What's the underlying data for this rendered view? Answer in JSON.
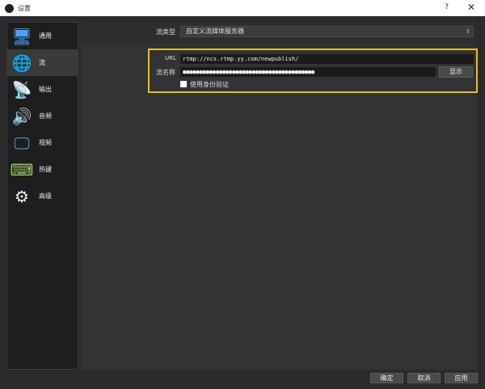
{
  "window": {
    "title": "设置",
    "help": "?",
    "close": "✕"
  },
  "sidebar": {
    "items": [
      {
        "label": "通用",
        "icon": "general-icon"
      },
      {
        "label": "流",
        "icon": "stream-icon"
      },
      {
        "label": "输出",
        "icon": "output-icon"
      },
      {
        "label": "音频",
        "icon": "audio-icon"
      },
      {
        "label": "视频",
        "icon": "video-icon"
      },
      {
        "label": "热键",
        "icon": "hotkeys-icon"
      },
      {
        "label": "高级",
        "icon": "advanced-icon"
      }
    ],
    "selected": "流"
  },
  "stream": {
    "type_label": "流类型",
    "type_value": "自定义流媒体服务器",
    "url_label": "URL",
    "url_value": "rtmp://ncs.rtmp.yy.com/newpublish/",
    "key_label": "流名称",
    "key_value": "●●●●●●●●●●●●●●●●●●●●●●●●●●●●●●●●●●●●●●●●",
    "show_button": "显示",
    "auth_label": "使用身份验证",
    "auth_checked": false
  },
  "footer": {
    "ok": "确定",
    "cancel": "取消",
    "apply": "应用"
  },
  "colors": {
    "highlight": "#e6c21a"
  }
}
